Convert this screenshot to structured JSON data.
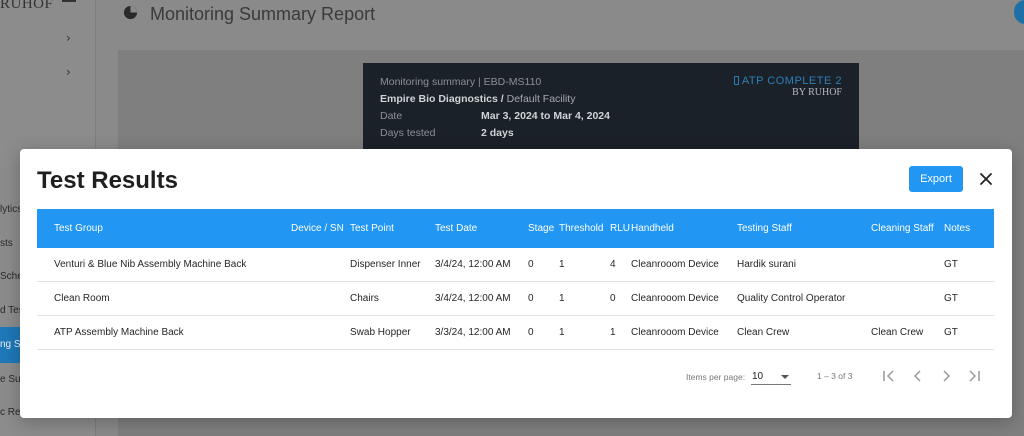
{
  "app": {
    "title": "Monitoring Summary Report",
    "logo": "RUHOF",
    "sidebar_items": [
      "lytics",
      "sts",
      "Sche",
      "d Tes",
      "ng Su",
      "e Su",
      "c Re"
    ]
  },
  "report_card": {
    "line1": "Monitoring summary | EBD-MS110",
    "company": "Empire Bio Diagnostics /",
    "facility": " Default Facility",
    "date_label": "Date",
    "date_value": "Mar 3, 2024 to Mar 4, 2024",
    "days_label": "Days tested",
    "days_value": "2 days",
    "brand_line1": "ATP COMPLETE 2",
    "brand_line2": "BY RUHOF"
  },
  "modal": {
    "title": "Test Results",
    "export_label": "Export",
    "columns": [
      "Test Group",
      "Device / SN",
      "Test Point",
      "Test Date",
      "Stage",
      "Threshold",
      "RLU",
      "Handheld",
      "Testing Staff",
      "Cleaning Staff",
      "Notes"
    ],
    "rows": [
      [
        "Venturi & Blue Nib Assembly Machine Back",
        "",
        "Dispenser Inner",
        "3/4/24, 12:00 AM",
        "0",
        "1",
        "4",
        "Cleanrooom Device",
        "Hardik surani",
        "",
        "GT"
      ],
      [
        "Clean Room",
        "",
        "Chairs",
        "3/4/24, 12:00 AM",
        "0",
        "1",
        "0",
        "Cleanrooom Device",
        "Quality Control Operator",
        "",
        "GT"
      ],
      [
        "ATP Assembly Machine Back",
        "",
        "Swab Hopper",
        "3/3/24, 12:00 AM",
        "0",
        "1",
        "1",
        "Cleanrooom Device",
        "Clean Crew",
        "Clean Crew",
        "GT"
      ]
    ],
    "paginator": {
      "items_per_page_label": "Items per page:",
      "items_per_page": "10",
      "range_label": "1 – 3 of 3"
    }
  },
  "colors": {
    "accent": "#2196f3",
    "card_bg": "#1b2128"
  }
}
